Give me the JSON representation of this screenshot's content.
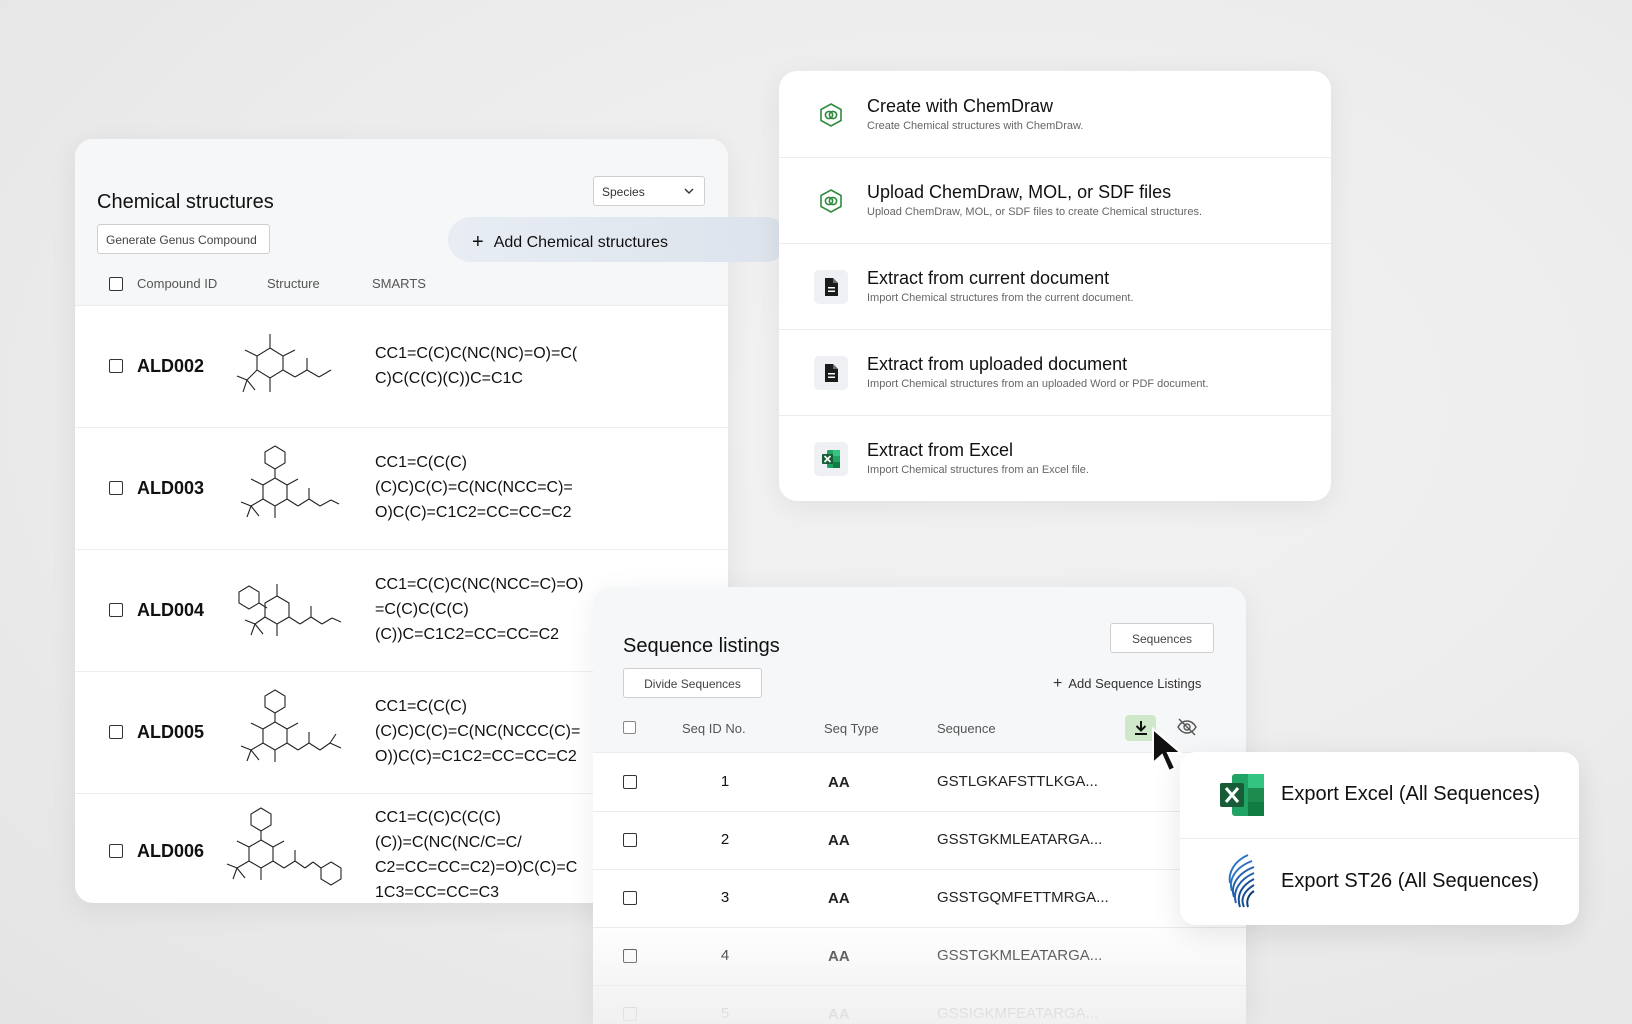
{
  "chemical_structures": {
    "title": "Chemical structures",
    "species_select": "Species",
    "generate_button": "Generate Genus Compound",
    "columns": {
      "compound_id": "Compound ID",
      "structure": "Structure",
      "smarts": "SMARTS"
    },
    "rows": [
      {
        "id": "ALD002",
        "smarts_lines": [
          "CC1=C(C)C(NC(NC)=O)=C(",
          "C)C(C(C)(C))C=C1C"
        ]
      },
      {
        "id": "ALD003",
        "smarts_lines": [
          "CC1=C(C(C)",
          "(C)C)C(C)=C(NC(NCC=C)=",
          "O)C(C)=C1C2=CC=CC=C2"
        ]
      },
      {
        "id": "ALD004",
        "smarts_lines": [
          "CC1=C(C)C(NC(NCC=C)=O)",
          "=C(C)C(C(C)",
          "(C))C=C1C2=CC=CC=C2"
        ]
      },
      {
        "id": "ALD005",
        "smarts_lines": [
          "CC1=C(C(C)",
          "(C)C)C(C)=C(NC(NCCC(C)=",
          "O))C(C)=C1C2=CC=CC=C2"
        ]
      },
      {
        "id": "ALD006",
        "smarts_lines": [
          "CC1=C(C)C(C(C)",
          "(C))=C(NC(NC/C=C/",
          "C2=CC=CC=C2)=O)C(C)=C",
          "1C3=CC=CC=C3"
        ]
      }
    ]
  },
  "add_chemical_button": "Add Chemical structures",
  "add_menu": {
    "items": [
      {
        "title": "Create with ChemDraw",
        "desc": "Create Chemical structures with ChemDraw.",
        "icon": "chemdraw-icon"
      },
      {
        "title": "Upload ChemDraw, MOL, or SDF files",
        "desc": "Upload ChemDraw, MOL, or SDF files to create Chemical structures.",
        "icon": "chemdraw-icon"
      },
      {
        "title": "Extract from current document",
        "desc": "Import Chemical structures from the current document.",
        "icon": "document-icon"
      },
      {
        "title": "Extract from uploaded document",
        "desc": "Import Chemical structures from an uploaded Word or PDF document.",
        "icon": "document-icon"
      },
      {
        "title": "Extract from Excel",
        "desc": "Import Chemical structures from an Excel file.",
        "icon": "excel-icon"
      }
    ]
  },
  "sequence_listings": {
    "title": "Sequence listings",
    "sequences_button": "Sequences",
    "divide_button": "Divide Sequences",
    "add_button": "Add Sequence Listings",
    "columns": {
      "seq_id": "Seq ID No.",
      "seq_type": "Seq Type",
      "sequence": "Sequence"
    },
    "rows": [
      {
        "id": "1",
        "type": "AA",
        "seq": "GSTLGKAFSTTLKGA..."
      },
      {
        "id": "2",
        "type": "AA",
        "seq": "GSSTGKMLEATARGA..."
      },
      {
        "id": "3",
        "type": "AA",
        "seq": "GSSTGQMFETTMRGA..."
      },
      {
        "id": "4",
        "type": "AA",
        "seq": "GSSTGKMLEATARGA..."
      },
      {
        "id": "5",
        "type": "AA",
        "seq": "GSSIGKMFEATARGA..."
      }
    ]
  },
  "export_menu": {
    "excel": "Export Excel (All Sequences)",
    "st26": "Export ST26 (All Sequences)"
  },
  "colors": {
    "accent_green": "#2e8b3e",
    "download_bg": "#cfe8c9",
    "excel_green": "#1d6f42"
  }
}
